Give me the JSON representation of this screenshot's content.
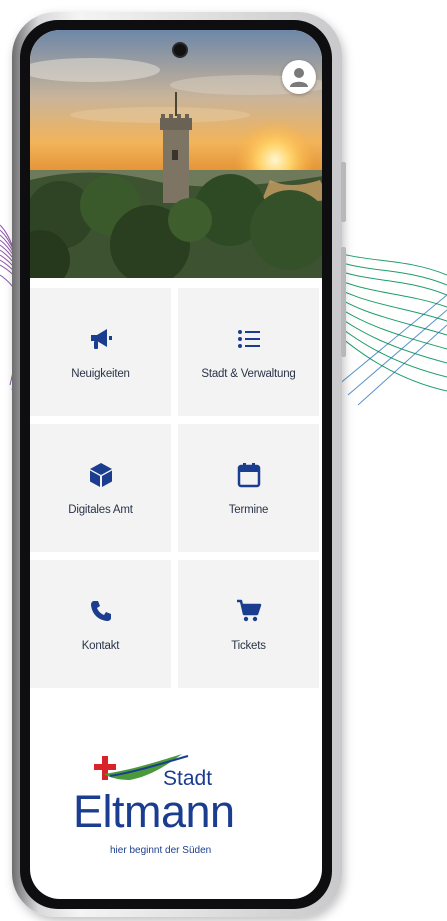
{
  "hero": {
    "photo": "castle-tower-sunset-landscape",
    "profile_icon": "user-icon"
  },
  "menu": {
    "items": [
      {
        "label": "Neuigkeiten",
        "icon": "megaphone-icon"
      },
      {
        "label": "Stadt & Verwaltung",
        "icon": "list-icon"
      },
      {
        "label": "Digitales Amt",
        "icon": "cube-icon"
      },
      {
        "label": "Termine",
        "icon": "calendar-icon"
      },
      {
        "label": "Kontakt",
        "icon": "phone-icon"
      },
      {
        "label": "Tickets",
        "icon": "cart-icon"
      }
    ],
    "icon_color": "#1b3d8f"
  },
  "logo": {
    "word_stadt": "Stadt",
    "word_name": "Eltmann",
    "tagline": "hier beginnt der Süden",
    "brand_blue": "#1b3d8f",
    "brand_red": "#d8232a",
    "brand_green": "#4a9a3a"
  }
}
